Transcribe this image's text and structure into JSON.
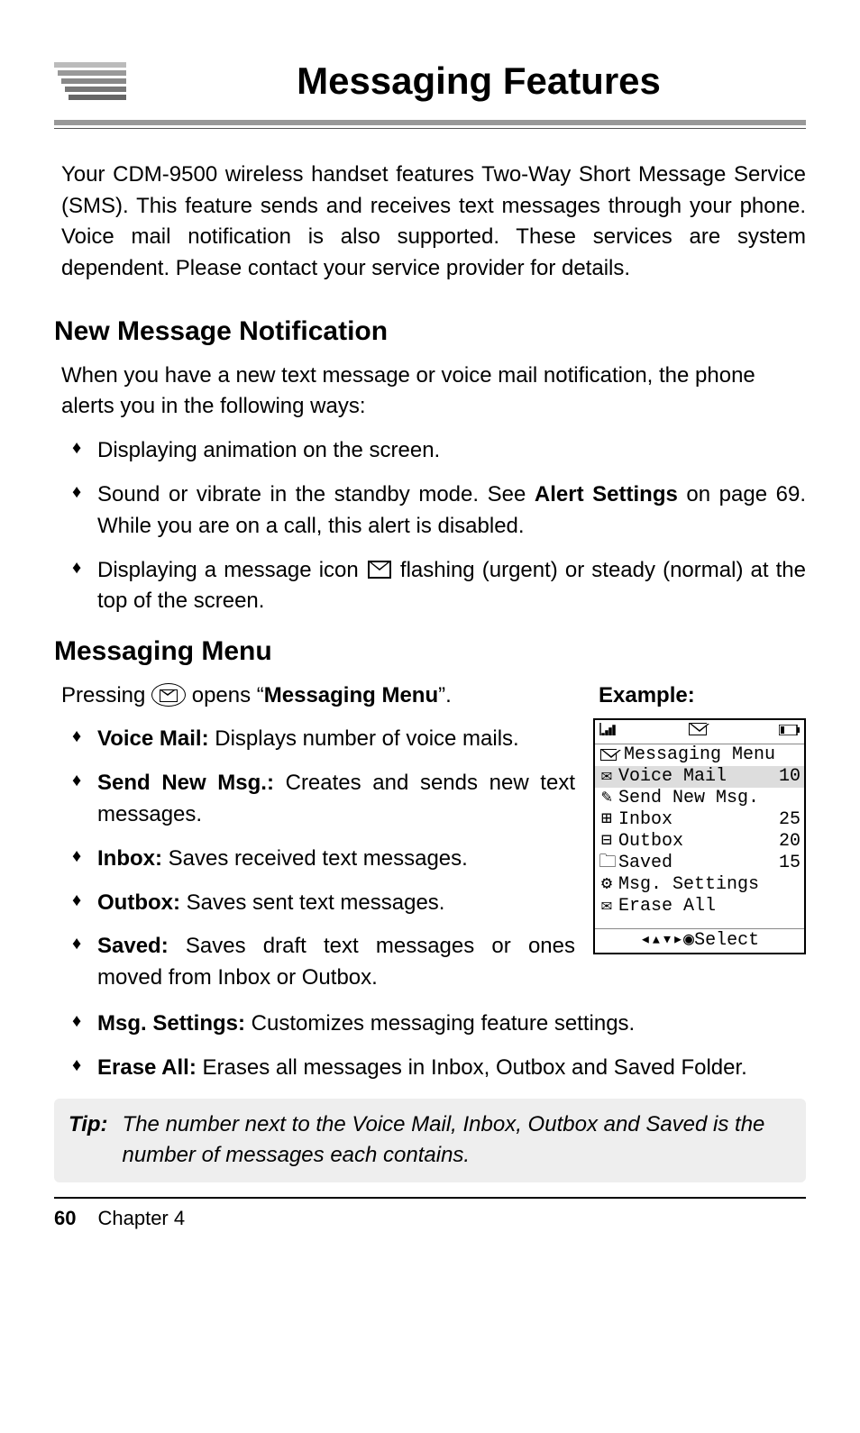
{
  "title": "Messaging Features",
  "intro": "Your CDM-9500 wireless handset features Two-Way Short Message Service (SMS). This feature sends and receives text messages through your phone. Voice mail notification is also supported. These services are system dependent. Please contact your service provider for details.",
  "section1": {
    "heading": "New Message Notification",
    "lead": "When you have a new text message or voice mail notification, the phone alerts you in the following ways:",
    "bullets": {
      "b1": "Displaying animation on the screen.",
      "b2a": "Sound or vibrate in the standby mode.  See ",
      "b2b": "Alert Settings",
      "b2c": " on page 69.  While you are on a call, this alert is disabled.",
      "b3a": "Displaying a message icon ",
      "b3b": " flashing (urgent) or steady (normal) at the top of the screen."
    }
  },
  "section2": {
    "heading": "Messaging Menu",
    "lead_a": "Pressing ",
    "lead_b": " opens “",
    "lead_c": "Messaging Menu",
    "lead_d": "”.",
    "bullets": [
      {
        "label": "Voice Mail:",
        "text": " Displays number of voice mails."
      },
      {
        "label": "Send New Msg.:",
        "text": " Creates and sends new text messages."
      },
      {
        "label": "Inbox:",
        "text": " Saves received text messages."
      },
      {
        "label": "Outbox:",
        "text": " Saves sent text messages."
      },
      {
        "label": "Saved:",
        "text": " Saves draft text messages or ones moved from Inbox or Outbox."
      },
      {
        "label": "Msg. Settings:",
        "text": " Customizes messaging feature settings."
      },
      {
        "label": "Erase All:",
        "text": " Erases all messages in Inbox, Outbox and Saved Folder."
      }
    ]
  },
  "example": {
    "label": "Example:",
    "screen_title": "Messaging Menu",
    "rows": [
      {
        "icon": "voicemail-icon",
        "label": "Voice Mail",
        "count": "10",
        "selected": true
      },
      {
        "icon": "compose-icon",
        "label": "Send New Msg.",
        "count": "",
        "selected": false
      },
      {
        "icon": "inbox-icon",
        "label": "Inbox",
        "count": "25",
        "selected": false
      },
      {
        "icon": "outbox-icon",
        "label": "Outbox",
        "count": "20",
        "selected": false
      },
      {
        "icon": "saved-icon",
        "label": "Saved",
        "count": "15",
        "selected": false
      },
      {
        "icon": "settings-icon",
        "label": "Msg. Settings",
        "count": "",
        "selected": false
      },
      {
        "icon": "erase-icon",
        "label": "Erase All",
        "count": "",
        "selected": false
      }
    ],
    "softkey": "Select",
    "softkey_nav": "◂▴▾▸",
    "status": {
      "signal": "▮▯▯",
      "msg": "✉",
      "battery": "▭"
    }
  },
  "tip": {
    "label": "Tip:",
    "text": "The number next to the Voice Mail, Inbox, Outbox and Saved is the number of messages each contains."
  },
  "footer": {
    "page": "60",
    "chapter": "Chapter 4"
  },
  "icons": {
    "voicemail": "✉",
    "compose": "✎",
    "inbox": "📥",
    "outbox": "📤",
    "saved": "🗀",
    "settings": "⚙",
    "erase": "✉",
    "envelope_small": "✉",
    "nav_key": "◈"
  }
}
